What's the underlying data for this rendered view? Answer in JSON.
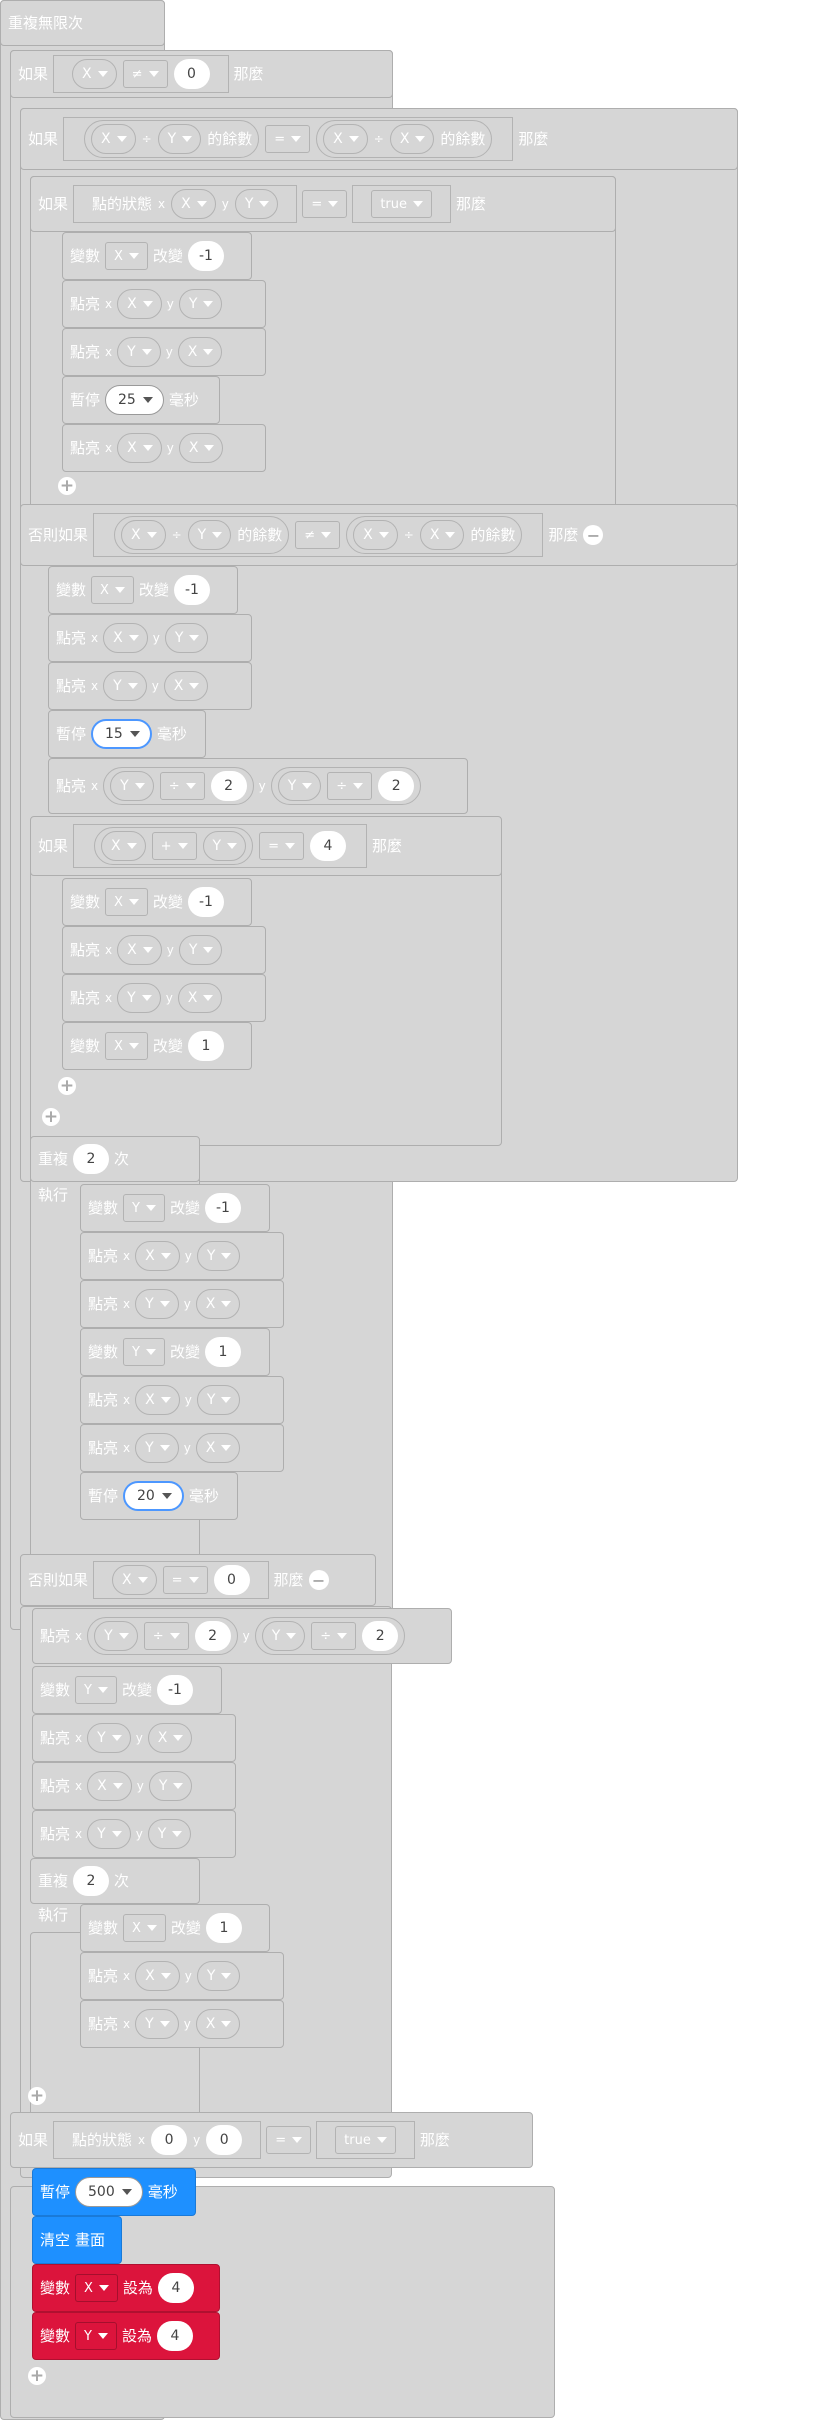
{
  "kw": {
    "forever": "重複無限次",
    "if": "如果",
    "then": "那麼",
    "elseif": "否則如果",
    "var": "變數",
    "change": "改變",
    "plot": "點亮",
    "x": "x",
    "y": "y",
    "pause": "暫停",
    "ms": "毫秒",
    "repeat": "重複",
    "times": "次",
    "do": "執行",
    "point": "點的狀態",
    "remainder": "的餘數",
    "set": "設為",
    "clear": "清空",
    "screen": "畫面",
    "X": "X",
    "Y": "Y",
    "ne": "≠",
    "eq": "=",
    "div": "÷",
    "add": "+",
    "true": "true"
  },
  "num": {
    "zero": "0",
    "neg1": "-1",
    "one": "1",
    "two": "2",
    "four": "4",
    "p25": "25",
    "p15": "15",
    "p20": "20",
    "p500": "500"
  }
}
